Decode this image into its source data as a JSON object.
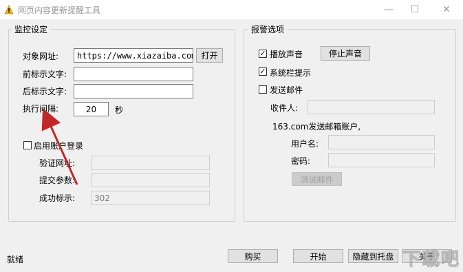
{
  "window": {
    "title": "网页内容更新提醒工具",
    "controls": {
      "minimize": "—",
      "maximize": "☐",
      "close": "✕"
    }
  },
  "monitor": {
    "title": "监控设定",
    "url_label": "对象网址:",
    "url_value": "https://www.xiazaiba.com/",
    "open_button": "打开",
    "prefix_label": "前标示文字:",
    "prefix_value": "",
    "suffix_label": "后标示文字:",
    "suffix_value": "",
    "interval_label": "执行间隔:",
    "interval_value": "20",
    "interval_unit": "秒",
    "login_checkbox_label": "启用账户登录",
    "login_checked": false,
    "verify_url_label": "验证网址:",
    "submit_params_label": "提交参数:",
    "success_mark_label": "成功标示:",
    "success_mark_value": "302"
  },
  "alarm": {
    "title": "报警选项",
    "play_sound_label": "播放声音",
    "play_sound_checked": true,
    "stop_sound_button": "停止声音",
    "tray_tip_label": "系统栏提示",
    "tray_tip_checked": true,
    "send_mail_label": "发送邮件",
    "send_mail_checked": false,
    "recipient_label": "收件人:",
    "sender_heading": "163.com发送邮箱账户,",
    "username_label": "用户名:",
    "password_label": "密码:",
    "test_mail_button": "测试邮件"
  },
  "footer": {
    "status": "就绪",
    "buy_button": "购买",
    "start_button": "开始",
    "hide_tray_button": "隐藏到托盘",
    "about_button": "关于"
  },
  "watermark": "下载吧",
  "colors": {
    "arrow": "#c0282a",
    "title_text": "#999999"
  }
}
